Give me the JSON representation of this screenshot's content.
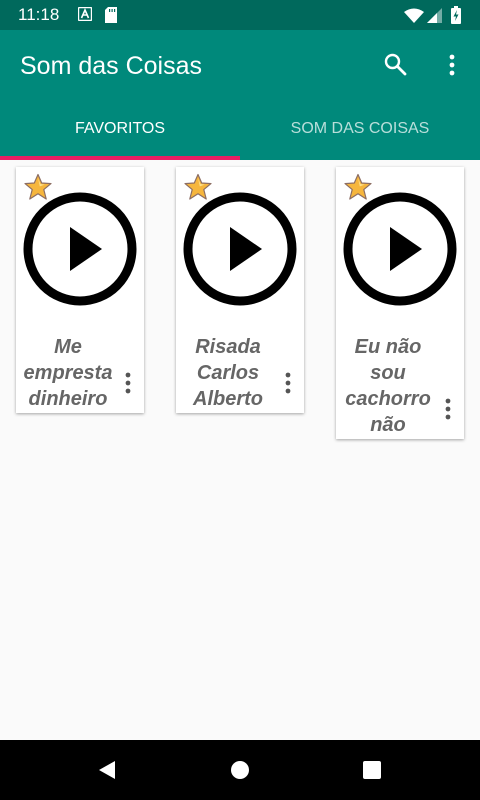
{
  "status_bar": {
    "time": "11:18"
  },
  "app_bar": {
    "title": "Som das Coisas"
  },
  "tabs": [
    {
      "label": "FAVORITOS",
      "active": true
    },
    {
      "label": "SOM DAS COISAS",
      "active": false
    }
  ],
  "cards": [
    {
      "lines": [
        "Me",
        "empresta",
        "dinheiro"
      ]
    },
    {
      "lines": [
        "Risada",
        "Carlos",
        "Alberto"
      ]
    },
    {
      "lines": [
        "Eu não",
        "sou",
        "cachorro",
        "não"
      ]
    }
  ],
  "colors": {
    "primary": "#00897b",
    "primary_dark": "#00695c",
    "accent": "#e91e63"
  }
}
